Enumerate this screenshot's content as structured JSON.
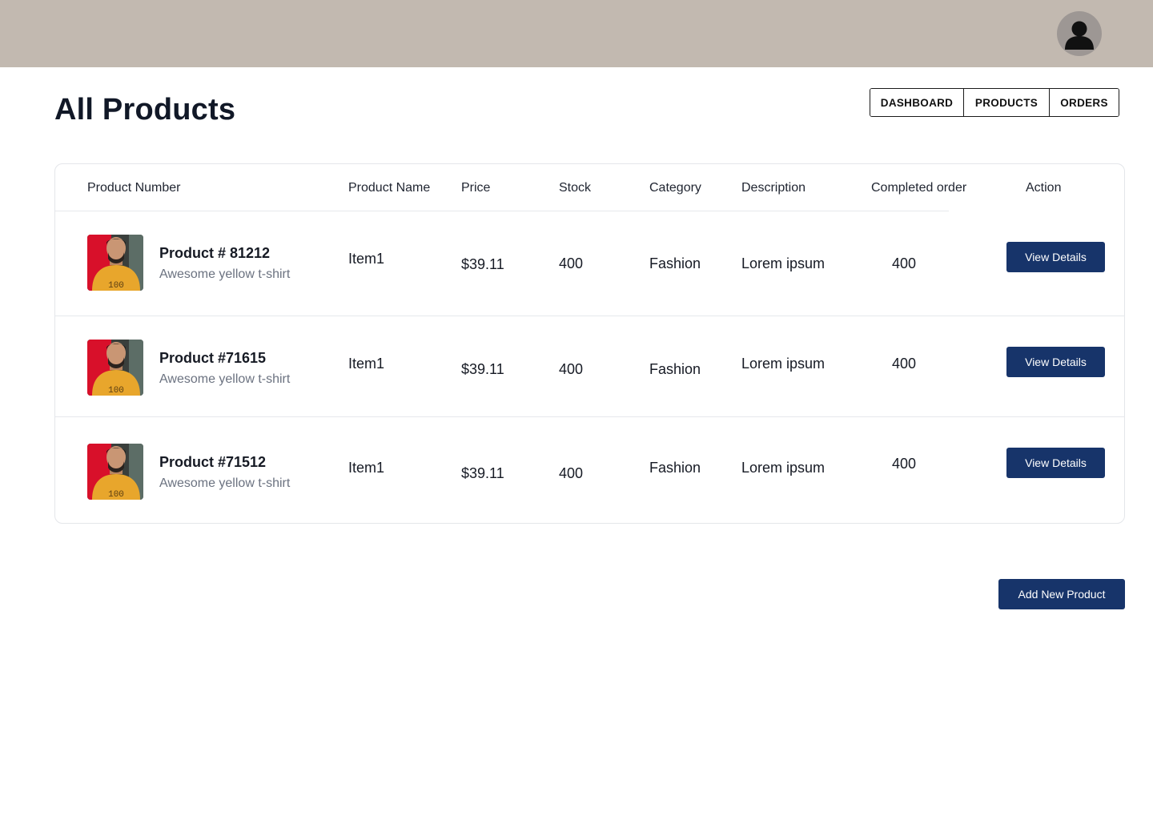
{
  "header": {
    "avatar_icon": "user-avatar-icon",
    "background": "#c2b9b0"
  },
  "page": {
    "title": "All Products"
  },
  "nav": {
    "items": [
      {
        "label": "DASHBOARD"
      },
      {
        "label": "PRODUCTS"
      },
      {
        "label": "ORDERS"
      }
    ]
  },
  "table": {
    "columns": [
      "Product Number",
      "Product Name",
      "Price",
      "Stock",
      "Category",
      "Description",
      "Completed order",
      "Action"
    ],
    "rows": [
      {
        "number": "Product # 81212",
        "subtitle": "Awesome yellow t-shirt",
        "name": "Item1",
        "price": "$39.11",
        "stock": "400",
        "category": "Fashion",
        "description": "Lorem ipsum",
        "completed": "400",
        "action_label": "View Details"
      },
      {
        "number": "Product #71615",
        "subtitle": "Awesome yellow t-shirt",
        "name": "Item1",
        "price": "$39.11",
        "stock": "400",
        "category": "Fashion",
        "description": "Lorem ipsum",
        "completed": "400",
        "action_label": "View Details"
      },
      {
        "number": "Product #71512",
        "subtitle": "Awesome yellow t-shirt",
        "name": "Item1",
        "price": "$39.11",
        "stock": "400",
        "category": "Fashion",
        "description": "Lorem ipsum",
        "completed": "400",
        "action_label": "View Details"
      }
    ]
  },
  "actions": {
    "add_label": "Add New Product"
  },
  "colors": {
    "accent": "#17346a",
    "topbar": "#c2b9b0",
    "muted_text": "#6b7280",
    "border": "#e4e6ea"
  }
}
